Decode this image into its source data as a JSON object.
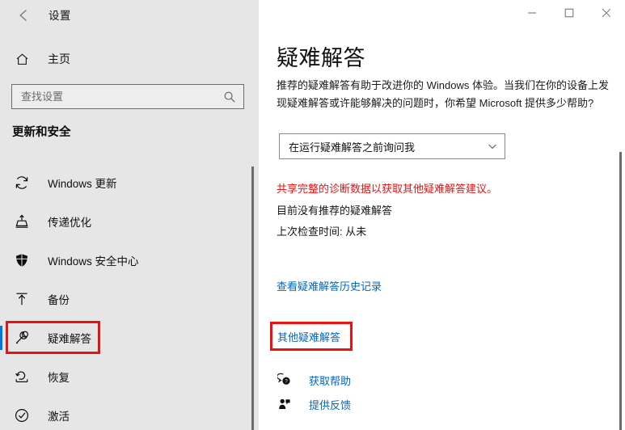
{
  "window": {
    "app_title": "设置",
    "back_icon": "back-arrow-icon",
    "minimize_label": "—",
    "maximize_label": "□",
    "close_label": "✕"
  },
  "sidebar": {
    "home": {
      "label": "主页",
      "icon": "home-icon"
    },
    "search": {
      "placeholder": "查找设置",
      "value": "",
      "icon": "search-icon"
    },
    "section_header": "更新和安全",
    "items": [
      {
        "label": "Windows 更新",
        "icon": "sync-icon",
        "selected": false,
        "highlighted": false
      },
      {
        "label": "传递优化",
        "icon": "delivery-optimization-icon",
        "selected": false,
        "highlighted": false
      },
      {
        "label": "Windows 安全中心",
        "icon": "shield-icon",
        "selected": false,
        "highlighted": false
      },
      {
        "label": "备份",
        "icon": "backup-upload-icon",
        "selected": false,
        "highlighted": false
      },
      {
        "label": "疑难解答",
        "icon": "wrench-icon",
        "selected": true,
        "highlighted": true
      },
      {
        "label": "恢复",
        "icon": "recovery-icon",
        "selected": false,
        "highlighted": false
      },
      {
        "label": "激活",
        "icon": "check-circle-icon",
        "selected": false,
        "highlighted": false
      }
    ]
  },
  "main": {
    "title": "疑难解答",
    "description": "推荐的疑难解答有助于改进你的 Windows 体验。当我们在你的设备上发现疑难解答或许能够解决的问题时，你希望 Microsoft 提供多少帮助?",
    "dropdown": {
      "selected": "在运行疑难解答之前询问我",
      "chevron_icon": "chevron-down-icon"
    },
    "warning_text": "共享完整的诊断数据以获取其他疑难解答建议。",
    "status_no_recommended": "目前没有推荐的疑难解答",
    "status_last_check": "上次检查时间: 从未",
    "link_history": "查看疑难解答历史记录",
    "link_other_troubleshooters": "其他疑难解答",
    "help_rows": [
      {
        "label": "获取帮助",
        "icon": "get-help-icon"
      },
      {
        "label": "提供反馈",
        "icon": "feedback-icon"
      }
    ]
  },
  "colors": {
    "accent": "#0078d7",
    "link": "#0067c0",
    "warning": "#ee1111",
    "highlight_box": "#ee1111",
    "sidebar_bg": "#e6e6e6"
  }
}
